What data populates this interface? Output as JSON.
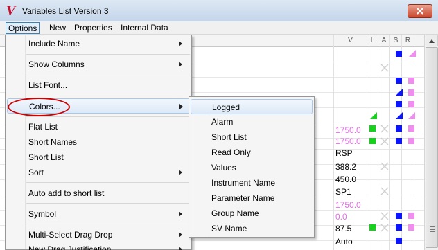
{
  "window": {
    "title": "Variables List Version 3"
  },
  "menubar": {
    "items": [
      "Options",
      "New",
      "Properties",
      "Internal Data"
    ]
  },
  "columns": {
    "v": "V",
    "l": "L",
    "a": "A",
    "s": "S",
    "r": "R"
  },
  "options_menu": {
    "items": [
      {
        "label": "Include Name",
        "submenu": true
      },
      {
        "label": "Show Columns",
        "submenu": true
      },
      {
        "label": "List Font...",
        "submenu": false
      },
      {
        "label": "Colors...",
        "submenu": true
      },
      {
        "label": "Flat List",
        "submenu": false
      },
      {
        "label": "Short Names",
        "submenu": false
      },
      {
        "label": "Short List",
        "submenu": false
      },
      {
        "label": "Sort",
        "submenu": true
      },
      {
        "label": "Auto add to short list",
        "submenu": false
      },
      {
        "label": "Symbol",
        "submenu": true
      },
      {
        "label": "Multi-Select Drag Drop",
        "submenu": true
      },
      {
        "label": "New Drag Justification",
        "submenu": true
      }
    ]
  },
  "colors_submenu": {
    "items": [
      "Logged",
      "Alarm",
      "Short List",
      "Read Only",
      "Values",
      "Instrument Name",
      "Parameter Name",
      "Group Name",
      "SV Name"
    ]
  },
  "list_values": [
    "1750.0",
    "1750.0",
    "RSP",
    "388.2",
    "450.0",
    "SP1",
    "1750.0",
    "0.0",
    "87.5",
    "Auto"
  ],
  "colors": {
    "accent_blue": "#0a14ff",
    "pink": "#e070e0",
    "green": "#17d21c",
    "highlight_border": "#a8c7ea",
    "annotation_red": "#d10000"
  }
}
